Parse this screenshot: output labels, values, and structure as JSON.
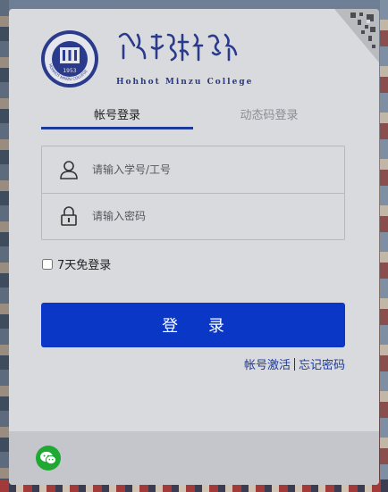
{
  "school": {
    "name_en": "Hohhot  Minzu  College",
    "emblem_year": "1953",
    "emblem_ring_text": "HOHHOT MINZU COLLEGE"
  },
  "tabs": {
    "account_login": "帐号登录",
    "dynamic_code_login": "动态码登录"
  },
  "form": {
    "username_placeholder": "请输入学号/工号",
    "password_placeholder": "请输入密码",
    "remember_label": "7天免登录",
    "login_button": "登 录"
  },
  "links": {
    "activate": "帐号激活",
    "forgot_password": "忘记密码"
  },
  "colors": {
    "primary": "#0a37c6",
    "tab_active_underline": "#1d3a9a",
    "wechat": "#1fa832"
  },
  "icons": [
    "user-icon",
    "lock-icon",
    "wechat-icon",
    "qr-code-icon",
    "school-emblem"
  ]
}
